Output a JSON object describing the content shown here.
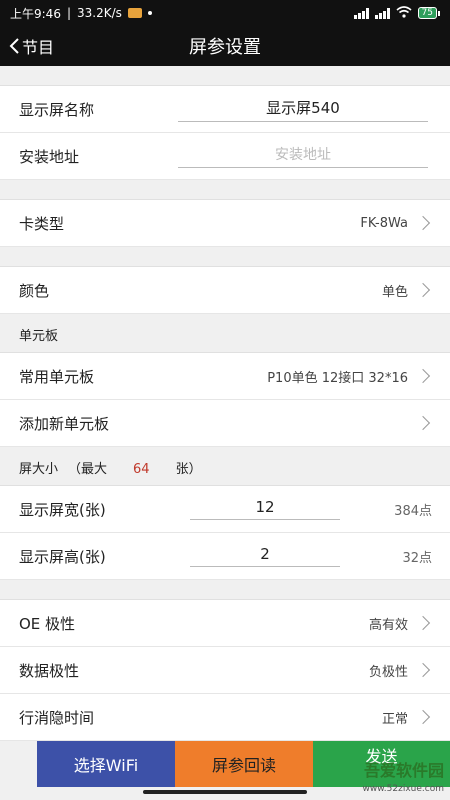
{
  "status": {
    "time": "上午9:46",
    "speed": "33.2K/s",
    "battery": "75"
  },
  "header": {
    "back_label": "节目",
    "title": "屏参设置"
  },
  "form": {
    "name_label": "显示屏名称",
    "name_value": "显示屏540",
    "address_label": "安装地址",
    "address_placeholder": "安装地址",
    "card_type_label": "卡类型",
    "card_type_value": "FK-8Wa",
    "color_label": "颜色",
    "color_value": "单色"
  },
  "unit_board": {
    "section_title": "单元板",
    "common_label": "常用单元板",
    "common_value": "P10单色 12接口 32*16",
    "add_label": "添加新单元板"
  },
  "screen_size": {
    "section_title": "屏大小",
    "max_prefix": "（最大",
    "max_value": "64",
    "max_suffix": "张）",
    "width_label": "显示屏宽(张)",
    "width_value": "12",
    "width_points": "384点",
    "height_label": "显示屏高(张)",
    "height_value": "2",
    "height_points": "32点"
  },
  "advanced": {
    "oe_label": "OE 极性",
    "oe_value": "高有效",
    "data_label": "数据极性",
    "data_value": "负极性",
    "blank_label": "行消隐时间",
    "blank_value": "正常"
  },
  "bottom": {
    "wifi_label": "选择WiFi",
    "read_label": "屏参回读",
    "send_label": "发送"
  },
  "watermark": {
    "name": "吾爱软件园",
    "url": "www.52zixue.com"
  }
}
